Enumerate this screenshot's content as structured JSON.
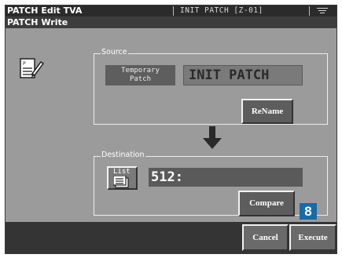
{
  "titlebar": {
    "title": "PATCH Edit TVA",
    "patch_info": "INIT PATCH   [Z-01]"
  },
  "dialog": {
    "title": "PATCH Write"
  },
  "source": {
    "group_label": "Source",
    "temp_label_line1": "Temporary",
    "temp_label_line2": "Patch",
    "patch_name": "INIT PATCH",
    "rename_label": "ReName"
  },
  "destination": {
    "group_label": "Destination",
    "list_label": "List",
    "value": "512:",
    "compare_label": "Compare"
  },
  "step_marker": "8",
  "bottombar": {
    "cancel_label": "Cancel",
    "execute_label": "Execute"
  },
  "icons": {
    "write": "write-patch-icon",
    "arrow": "arrow-down-icon",
    "list": "list-icon",
    "menu": "menu-icon"
  },
  "colors": {
    "step_marker": "#1a6aa6"
  }
}
